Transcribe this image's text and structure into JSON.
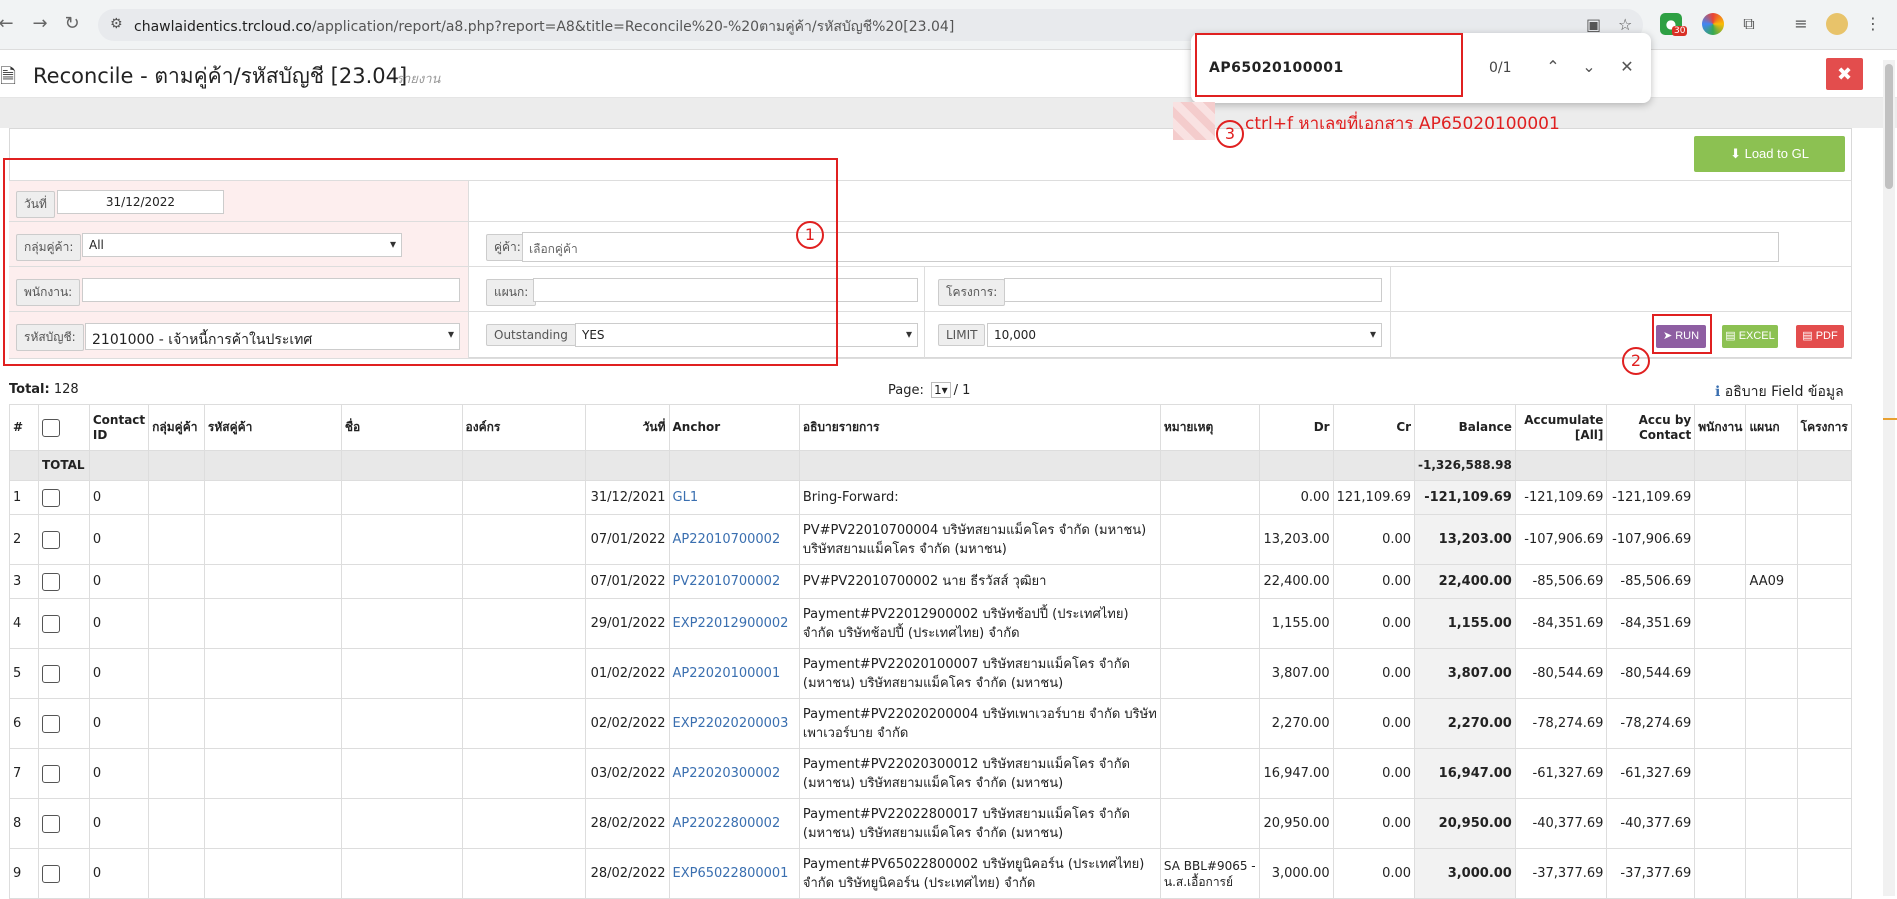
{
  "browser": {
    "url_host": "chawlaidentics.trcloud.co",
    "url_path": "/application/report/a8.php?report=A8&title=Reconcile%20-%20ตามคู่ค้า/รหัสบัญชี%20[23.04]",
    "extension_badge": "30"
  },
  "find_bar": {
    "query": "AP65020100001",
    "count": "0/1"
  },
  "header": {
    "title": "Reconcile - ตามคู่ค้า/รหัสบัญชี [23.04]",
    "subtitle": "รายงาน",
    "close_symbol": "✖"
  },
  "annotation": {
    "text": "ctrl+f หาเลขที่เอกสาร AP65020100001",
    "markers": [
      "1",
      "2",
      "3"
    ]
  },
  "toolbar": {
    "load_gl": "Load to GL"
  },
  "filters": {
    "date_label": "วันที่",
    "date_value": "31/12/2022",
    "group_label": "กลุ่มคู่ค้า:",
    "group_value": "All",
    "partner_label": "คู่ค้า:",
    "partner_placeholder": "เลือกคู่ค้า",
    "employee_label": "พนักงาน:",
    "department_label": "แผนก:",
    "project_label": "โครงการ:",
    "account_label": "รหัสบัญชี:",
    "account_value": "2101000 - เจ้าหนี้การค้าในประเทศ",
    "outstanding_label": "Outstanding",
    "outstanding_value": "YES",
    "limit_label": "LIMIT",
    "limit_value": "10,000",
    "run": "RUN",
    "excel": "EXCEL",
    "pdf": "PDF"
  },
  "summary": {
    "total_label": "Total:",
    "total_value": "128",
    "page_label": "Page:",
    "page_value": "1",
    "page_of": "/ 1",
    "info_text": "อธิบาย Field ข้อมูล"
  },
  "table": {
    "headers": [
      "#",
      "",
      "Contact ID",
      "กลุ่มคู่ค้า",
      "รหัสคู่ค้า",
      "ชื่อ",
      "องค์กร",
      "วันที่",
      "Anchor",
      "อธิบายรายการ",
      "หมายเหตุ",
      "Dr",
      "Cr",
      "Balance",
      "Accumulate [All]",
      "Accu by Contact",
      "พนักงาน",
      "แผนก",
      "โครงการ"
    ],
    "total_row": {
      "label": "TOTAL",
      "balance": "-1,326,588.98"
    },
    "rows": [
      {
        "no": "1",
        "contact": "0",
        "date": "31/12/2021",
        "anchor": "GL1",
        "desc": "Bring-Forward:",
        "note": "",
        "dr": "0.00",
        "cr": "121,109.69",
        "balance": "-121,109.69",
        "acc": "-121,109.69",
        "acc_contact": "-121,109.69",
        "dept": ""
      },
      {
        "no": "2",
        "contact": "0",
        "date": "07/01/2022",
        "anchor": "AP22010700002",
        "desc": "PV#PV22010700004 บริษัทสยามแม็คโคร จำกัด (มหาชน) บริษัทสยามแม็คโคร จำกัด (มหาชน)",
        "note": "",
        "dr": "13,203.00",
        "cr": "0.00",
        "balance": "13,203.00",
        "acc": "-107,906.69",
        "acc_contact": "-107,906.69",
        "dept": ""
      },
      {
        "no": "3",
        "contact": "0",
        "date": "07/01/2022",
        "anchor": "PV22010700002",
        "desc": "PV#PV22010700002 นาย ธีรวัสส์ วุฒิยา",
        "note": "",
        "dr": "22,400.00",
        "cr": "0.00",
        "balance": "22,400.00",
        "acc": "-85,506.69",
        "acc_contact": "-85,506.69",
        "dept": "AA09"
      },
      {
        "no": "4",
        "contact": "0",
        "date": "29/01/2022",
        "anchor": "EXP22012900002",
        "desc": "Payment#PV22012900002 บริษัทช้อปปี้ (ประเทศไทย) จำกัด บริษัทช้อปปี้ (ประเทศไทย) จำกัด",
        "note": "",
        "dr": "1,155.00",
        "cr": "0.00",
        "balance": "1,155.00",
        "acc": "-84,351.69",
        "acc_contact": "-84,351.69",
        "dept": ""
      },
      {
        "no": "5",
        "contact": "0",
        "date": "01/02/2022",
        "anchor": "AP22020100001",
        "desc": "Payment#PV22020100007 บริษัทสยามแม็คโคร จำกัด (มหาชน) บริษัทสยามแม็คโคร จำกัด (มหาชน)",
        "note": "",
        "dr": "3,807.00",
        "cr": "0.00",
        "balance": "3,807.00",
        "acc": "-80,544.69",
        "acc_contact": "-80,544.69",
        "dept": ""
      },
      {
        "no": "6",
        "contact": "0",
        "date": "02/02/2022",
        "anchor": "EXP22020200003",
        "desc": "Payment#PV22020200004 บริษัทเพาเวอร์บาย จำกัด บริษัทเพาเวอร์บาย จำกัด",
        "note": "",
        "dr": "2,270.00",
        "cr": "0.00",
        "balance": "2,270.00",
        "acc": "-78,274.69",
        "acc_contact": "-78,274.69",
        "dept": ""
      },
      {
        "no": "7",
        "contact": "0",
        "date": "03/02/2022",
        "anchor": "AP22020300002",
        "desc": "Payment#PV22020300012 บริษัทสยามแม็คโคร จำกัด (มหาชน) บริษัทสยามแม็คโคร จำกัด (มหาชน)",
        "note": "",
        "dr": "16,947.00",
        "cr": "0.00",
        "balance": "16,947.00",
        "acc": "-61,327.69",
        "acc_contact": "-61,327.69",
        "dept": ""
      },
      {
        "no": "8",
        "contact": "0",
        "date": "28/02/2022",
        "anchor": "AP22022800002",
        "desc": "Payment#PV22022800017 บริษัทสยามแม็คโคร จำกัด (มหาชน) บริษัทสยามแม็คโคร จำกัด (มหาชน)",
        "note": "",
        "dr": "20,950.00",
        "cr": "0.00",
        "balance": "20,950.00",
        "acc": "-40,377.69",
        "acc_contact": "-40,377.69",
        "dept": ""
      },
      {
        "no": "9",
        "contact": "0",
        "date": "28/02/2022",
        "anchor": "EXP65022800001",
        "desc": "Payment#PV65022800002 บริษัทยูนิคอร์น (ประเทศไทย) จำกัด บริษัทยูนิคอร์น (ประเทศไทย) จำกัด",
        "note": "SA BBL#9065 - น.ส.เอื้อการย์",
        "dr": "3,000.00",
        "cr": "0.00",
        "balance": "3,000.00",
        "acc": "-37,377.69",
        "acc_contact": "-37,377.69",
        "dept": ""
      }
    ]
  }
}
